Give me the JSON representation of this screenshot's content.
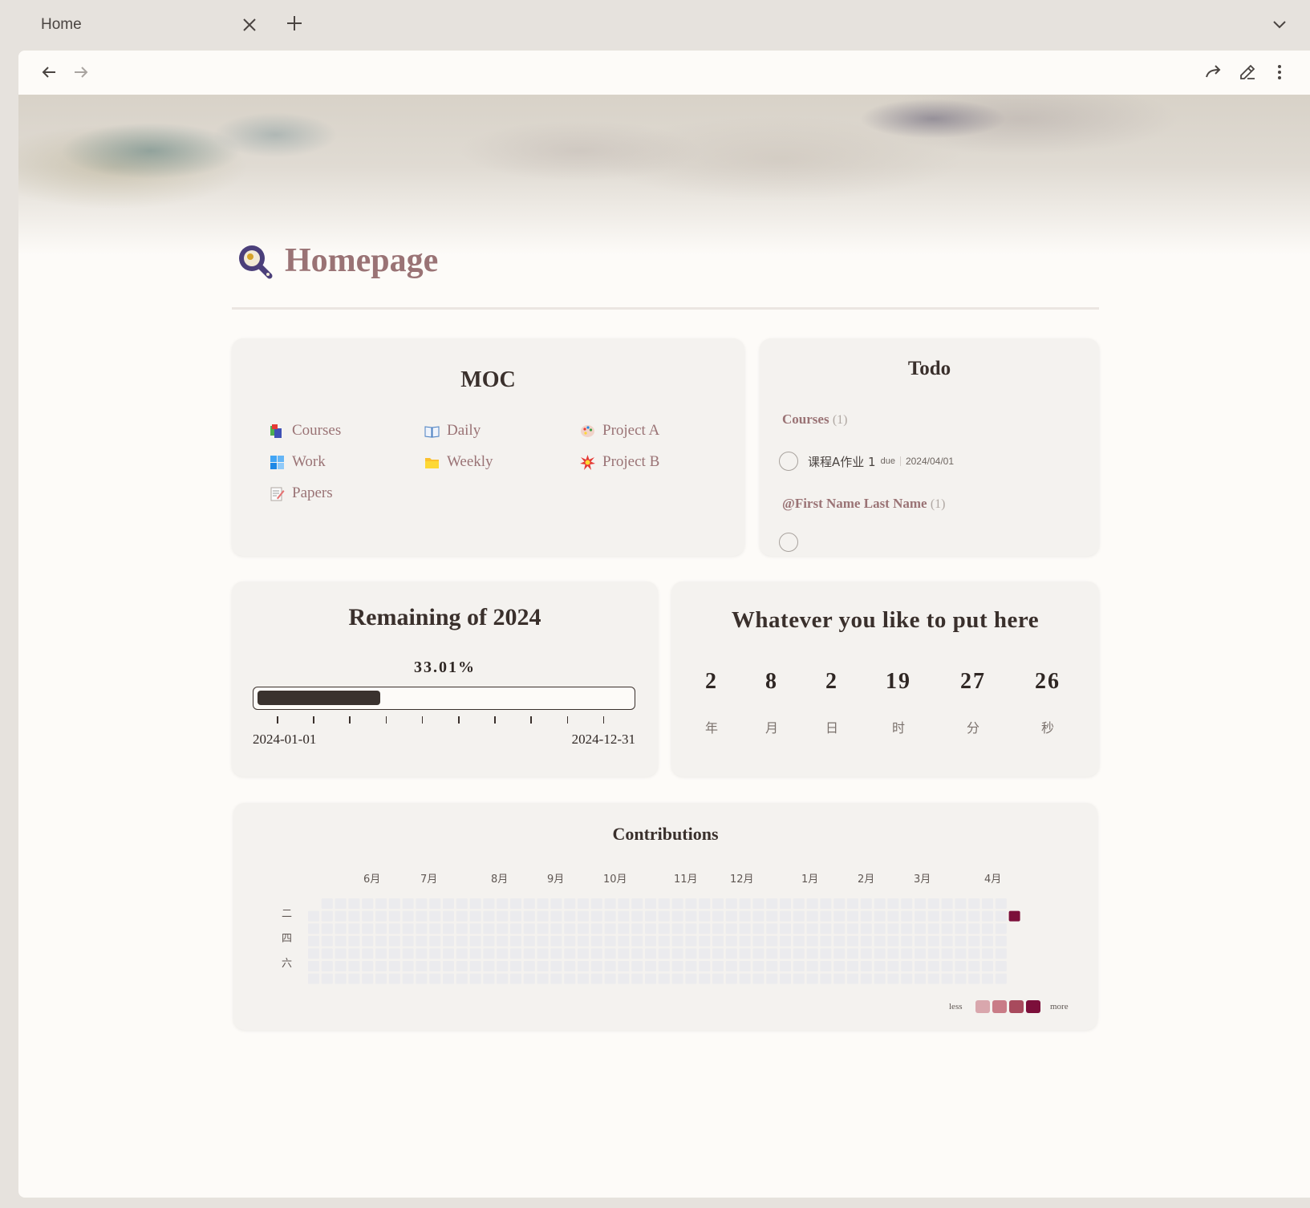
{
  "tab": {
    "title": "Home"
  },
  "page": {
    "title": "Homepage"
  },
  "moc": {
    "title": "MOC",
    "items": [
      {
        "label": "Courses",
        "icon": "books-icon"
      },
      {
        "label": "Daily",
        "icon": "open-book-icon"
      },
      {
        "label": "Project A",
        "icon": "palette-icon"
      },
      {
        "label": "Work",
        "icon": "windows-tiles-icon"
      },
      {
        "label": "Weekly",
        "icon": "folder-icon"
      },
      {
        "label": "Project B",
        "icon": "explosion-icon"
      },
      {
        "label": "Papers",
        "icon": "memo-icon"
      }
    ]
  },
  "todo": {
    "title": "Todo",
    "groups": [
      {
        "name": "Courses",
        "count": "(1)"
      },
      {
        "name": "@First Name Last Name",
        "count": "(1)"
      }
    ],
    "items": [
      {
        "text": "课程A作业 1",
        "due_label": "due",
        "date": "2024/04/01"
      }
    ]
  },
  "remaining": {
    "title": "Remaining of 2024",
    "percent_text": "33.01%",
    "progress": 0.3301,
    "start_date": "2024-01-01",
    "end_date": "2024-12-31"
  },
  "counter": {
    "title": "Whatever you like to put here",
    "parts": [
      {
        "value": "2",
        "unit": "年"
      },
      {
        "value": "8",
        "unit": "月"
      },
      {
        "value": "2",
        "unit": "日"
      },
      {
        "value": "19",
        "unit": "时"
      },
      {
        "value": "27",
        "unit": "分"
      },
      {
        "value": "26",
        "unit": "秒"
      }
    ]
  },
  "contributions": {
    "title": "Contributions",
    "months": [
      "6月",
      "7月",
      "8月",
      "9月",
      "10月",
      "11月",
      "12月",
      "1月",
      "2月",
      "3月",
      "4月"
    ],
    "weekdays": [
      "二",
      "四",
      "六"
    ],
    "legend_less": "less",
    "legend_more": "more",
    "legend_colors": [
      "#d9a7ad",
      "#c97c87",
      "#a84a5d",
      "#7c0f3a"
    ],
    "empty_color": "#ebebee",
    "active_cell": {
      "week": 52,
      "day": 1
    }
  },
  "colors": {
    "accent": "#9a7375",
    "progress": "#3a322e",
    "window_bg": "#fdfbf8",
    "card_bg": "#f4f2ef"
  }
}
